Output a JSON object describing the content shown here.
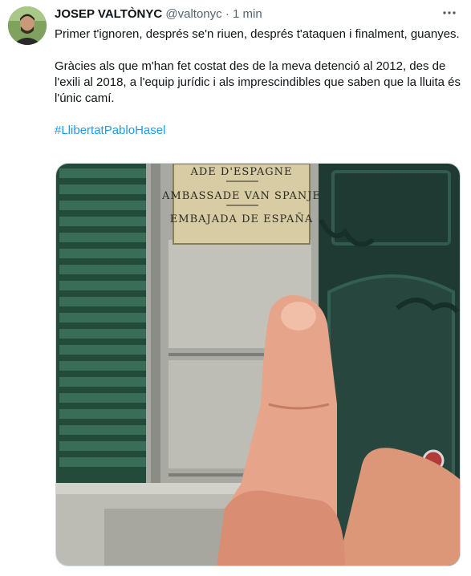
{
  "tweet": {
    "author_name": "JOSEP VALTÒNYC",
    "author_handle": "@valtonyc",
    "separator": "·",
    "time": "1 min",
    "paragraph_1": "Primer t'ignoren, després se'n riuen, després t'ataquen i finalment, guanyes.",
    "paragraph_2": "Gràcies als que m'han fet costat des de la meva detenció al 2012, des de l'exili al 2018, a l'equip jurídic i als imprescindibles que saben que la lluita és l'únic camí.",
    "hashtag": "#LlibertatPabloHasel",
    "more_icon": "more-icon"
  },
  "media": {
    "plaque_lines": [
      "ADE D'ESPAGNE",
      "AMBASSADE VAN SPANJE",
      "EMBAJADA DE ESPAÑA"
    ]
  },
  "colors": {
    "link": "#1d9bf0",
    "secondary_text": "#536471",
    "door_green": "#1f3a33",
    "shutter_green": "#2e5b49"
  }
}
